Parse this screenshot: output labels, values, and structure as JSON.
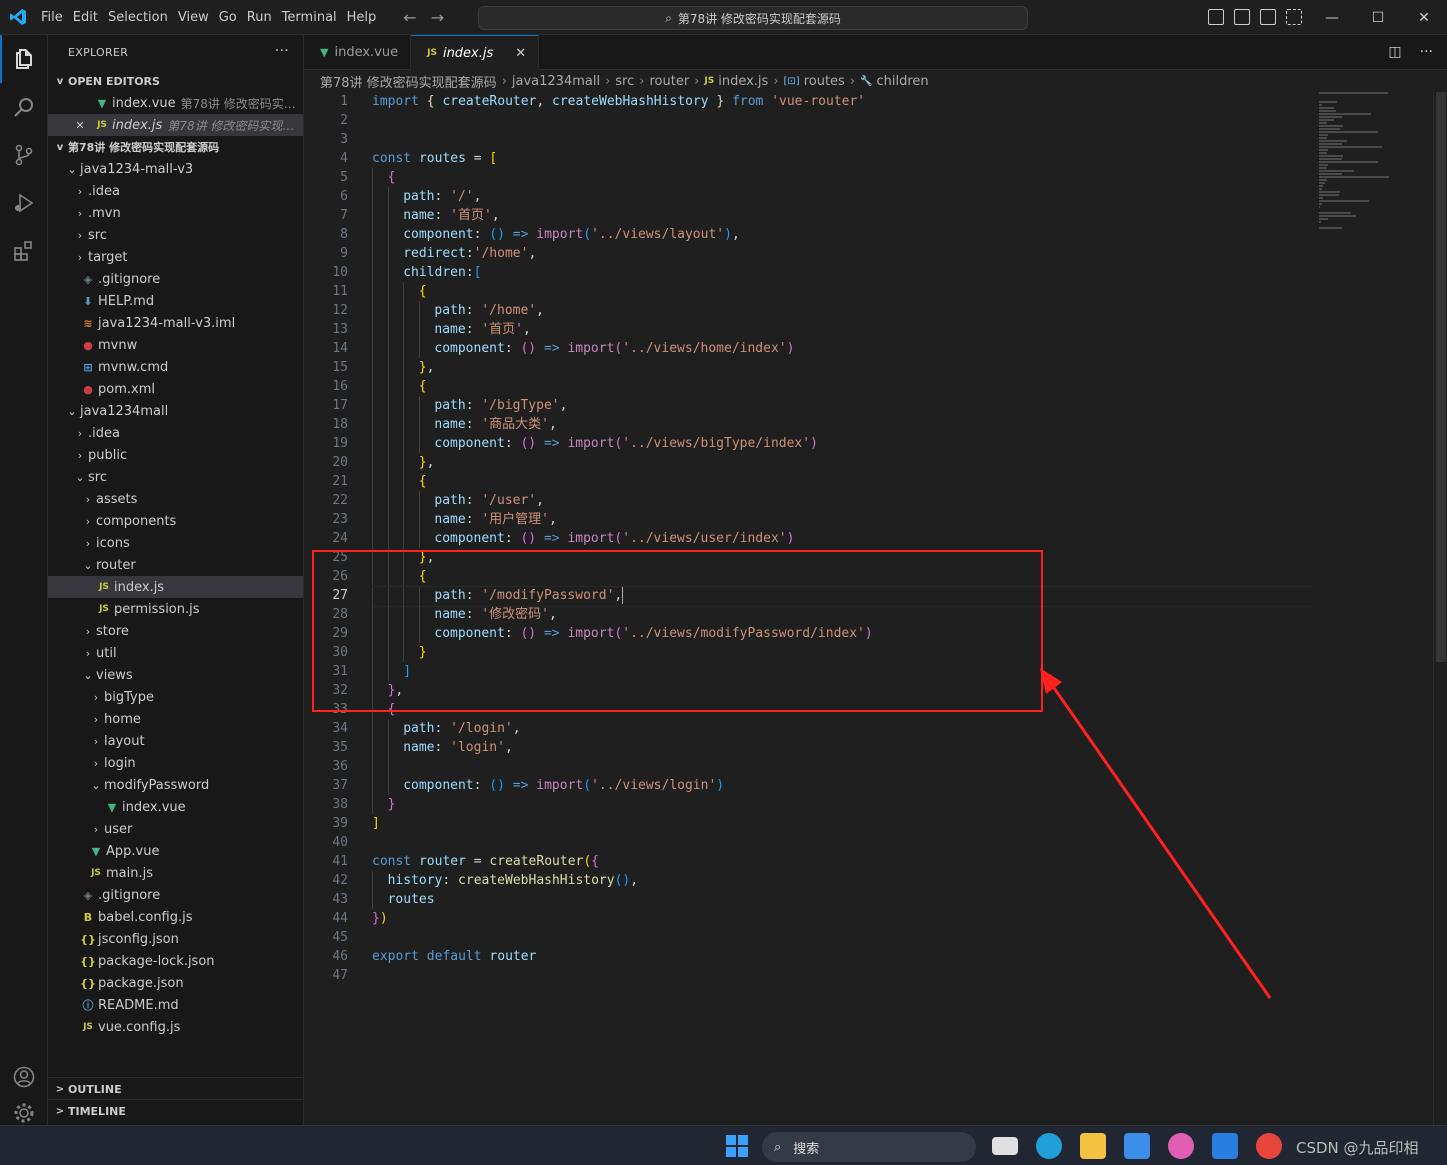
{
  "menu": [
    "File",
    "Edit",
    "Selection",
    "View",
    "Go",
    "Run",
    "Terminal",
    "Help"
  ],
  "command_center": "第78讲 修改密码实现配套源码",
  "explorer": {
    "title": "EXPLORER",
    "open_editors_label": "OPEN EDITORS",
    "open_editors": [
      {
        "name": "index.vue",
        "desc": "第78讲 修改密码实现配..."
      },
      {
        "name": "index.js",
        "desc": "第78讲 修改密码实现配套..."
      }
    ],
    "workspace_label": "第78讲 修改密码实现配套源码",
    "tree": [
      {
        "label": "第78讲 修改密码实现配套源码",
        "depth": 1,
        "chev": "v",
        "icon": ""
      },
      {
        "label": "java1234-mall-v3",
        "depth": 2,
        "chev": "v",
        "icon": ""
      },
      {
        "label": ".idea",
        "depth": 3,
        "chev": ">",
        "icon": ""
      },
      {
        "label": ".mvn",
        "depth": 3,
        "chev": ">",
        "icon": ""
      },
      {
        "label": "src",
        "depth": 3,
        "chev": ">",
        "icon": ""
      },
      {
        "label": "target",
        "depth": 3,
        "chev": ">",
        "icon": ""
      },
      {
        "label": ".gitignore",
        "depth": 3,
        "chev": "",
        "icon": "git"
      },
      {
        "label": "HELP.md",
        "depth": 3,
        "chev": "",
        "icon": "md"
      },
      {
        "label": "java1234-mall-v3.iml",
        "depth": 3,
        "chev": "",
        "icon": "xml"
      },
      {
        "label": "mvnw",
        "depth": 3,
        "chev": "",
        "icon": "red"
      },
      {
        "label": "mvnw.cmd",
        "depth": 3,
        "chev": "",
        "icon": "cmd"
      },
      {
        "label": "pom.xml",
        "depth": 3,
        "chev": "",
        "icon": "red"
      },
      {
        "label": "java1234mall",
        "depth": 2,
        "chev": "v",
        "icon": ""
      },
      {
        "label": ".idea",
        "depth": 3,
        "chev": ">",
        "icon": ""
      },
      {
        "label": "public",
        "depth": 3,
        "chev": ">",
        "icon": ""
      },
      {
        "label": "src",
        "depth": 3,
        "chev": "v",
        "icon": ""
      },
      {
        "label": "assets",
        "depth": 4,
        "chev": ">",
        "icon": ""
      },
      {
        "label": "components",
        "depth": 4,
        "chev": ">",
        "icon": ""
      },
      {
        "label": "icons",
        "depth": 4,
        "chev": ">",
        "icon": ""
      },
      {
        "label": "router",
        "depth": 4,
        "chev": "v",
        "icon": ""
      },
      {
        "label": "index.js",
        "depth": 5,
        "chev": "",
        "icon": "js",
        "selected": true
      },
      {
        "label": "permission.js",
        "depth": 5,
        "chev": "",
        "icon": "js"
      },
      {
        "label": "store",
        "depth": 4,
        "chev": ">",
        "icon": ""
      },
      {
        "label": "util",
        "depth": 4,
        "chev": ">",
        "icon": ""
      },
      {
        "label": "views",
        "depth": 4,
        "chev": "v",
        "icon": ""
      },
      {
        "label": "bigType",
        "depth": 5,
        "chev": ">",
        "icon": ""
      },
      {
        "label": "home",
        "depth": 5,
        "chev": ">",
        "icon": ""
      },
      {
        "label": "layout",
        "depth": 5,
        "chev": ">",
        "icon": ""
      },
      {
        "label": "login",
        "depth": 5,
        "chev": ">",
        "icon": ""
      },
      {
        "label": "modifyPassword",
        "depth": 5,
        "chev": "v",
        "icon": ""
      },
      {
        "label": "index.vue",
        "depth": 6,
        "chev": "",
        "icon": "vue"
      },
      {
        "label": "user",
        "depth": 5,
        "chev": ">",
        "icon": ""
      },
      {
        "label": "App.vue",
        "depth": 4,
        "chev": "",
        "icon": "vue"
      },
      {
        "label": "main.js",
        "depth": 4,
        "chev": "",
        "icon": "js"
      },
      {
        "label": ".gitignore",
        "depth": 3,
        "chev": "",
        "icon": "git"
      },
      {
        "label": "babel.config.js",
        "depth": 3,
        "chev": "",
        "icon": "babel"
      },
      {
        "label": "jsconfig.json",
        "depth": 3,
        "chev": "",
        "icon": "json"
      },
      {
        "label": "package-lock.json",
        "depth": 3,
        "chev": "",
        "icon": "json"
      },
      {
        "label": "package.json",
        "depth": 3,
        "chev": "",
        "icon": "json"
      },
      {
        "label": "README.md",
        "depth": 3,
        "chev": "",
        "icon": "info"
      },
      {
        "label": "vue.config.js",
        "depth": 3,
        "chev": "",
        "icon": "js"
      }
    ],
    "outline_label": "OUTLINE",
    "timeline_label": "TIMELINE"
  },
  "tabs": [
    {
      "name": "index.vue",
      "icon": "vue",
      "active": false
    },
    {
      "name": "index.js",
      "icon": "js",
      "active": true
    }
  ],
  "breadcrumb": [
    "第78讲 修改密码实现配套源码",
    "java1234mall",
    "src",
    "router",
    "index.js",
    "routes",
    "children"
  ],
  "code": {
    "current_line": 27,
    "lines": [
      [
        [
          "k",
          "import "
        ],
        [
          "pl",
          "{ "
        ],
        [
          "v",
          "createRouter"
        ],
        [
          "pl",
          ", "
        ],
        [
          "v",
          "createWebHashHistory"
        ],
        [
          "pl",
          " } "
        ],
        [
          "k",
          "from "
        ],
        [
          "s",
          "'vue-router'"
        ]
      ],
      [],
      [],
      [
        [
          "k",
          "const "
        ],
        [
          "v",
          "routes"
        ],
        [
          "pl",
          " = "
        ],
        [
          "b1",
          "["
        ]
      ],
      [
        [
          "i",
          1
        ],
        [
          "b2",
          "{"
        ]
      ],
      [
        [
          "i",
          2
        ],
        [
          "v",
          "path"
        ],
        [
          "pl",
          ": "
        ],
        [
          "s",
          "'/'"
        ],
        [
          "pl",
          ","
        ]
      ],
      [
        [
          "i",
          2
        ],
        [
          "v",
          "name"
        ],
        [
          "pl",
          ": "
        ],
        [
          "s",
          "'首页'"
        ],
        [
          "pl",
          ","
        ]
      ],
      [
        [
          "i",
          2
        ],
        [
          "v",
          "component"
        ],
        [
          "pl",
          ": "
        ],
        [
          "b3",
          "()"
        ],
        [
          "k",
          " => "
        ],
        [
          "kc",
          "import"
        ],
        [
          "b3",
          "("
        ],
        [
          "s",
          "'../views/layout'"
        ],
        [
          "b3",
          ")"
        ],
        [
          "pl",
          ","
        ]
      ],
      [
        [
          "i",
          2
        ],
        [
          "v",
          "redirect"
        ],
        [
          "pl",
          ":"
        ],
        [
          "s",
          "'/home'"
        ],
        [
          "pl",
          ","
        ]
      ],
      [
        [
          "i",
          2
        ],
        [
          "v",
          "children"
        ],
        [
          "pl",
          ":"
        ],
        [
          "b3",
          "["
        ]
      ],
      [
        [
          "i",
          3
        ],
        [
          "b1",
          "{"
        ]
      ],
      [
        [
          "i",
          4
        ],
        [
          "v",
          "path"
        ],
        [
          "pl",
          ": "
        ],
        [
          "s",
          "'/home'"
        ],
        [
          "pl",
          ","
        ]
      ],
      [
        [
          "i",
          4
        ],
        [
          "v",
          "name"
        ],
        [
          "pl",
          ": "
        ],
        [
          "s",
          "'首页'"
        ],
        [
          "pl",
          ","
        ]
      ],
      [
        [
          "i",
          4
        ],
        [
          "v",
          "component"
        ],
        [
          "pl",
          ": "
        ],
        [
          "b2",
          "()"
        ],
        [
          "k",
          " => "
        ],
        [
          "kc",
          "import"
        ],
        [
          "b2",
          "("
        ],
        [
          "s",
          "'../views/home/index'"
        ],
        [
          "b2",
          ")"
        ]
      ],
      [
        [
          "i",
          3
        ],
        [
          "b1",
          "}"
        ],
        [
          "pl",
          ","
        ]
      ],
      [
        [
          "i",
          3
        ],
        [
          "b1",
          "{"
        ]
      ],
      [
        [
          "i",
          4
        ],
        [
          "v",
          "path"
        ],
        [
          "pl",
          ": "
        ],
        [
          "s",
          "'/bigType'"
        ],
        [
          "pl",
          ","
        ]
      ],
      [
        [
          "i",
          4
        ],
        [
          "v",
          "name"
        ],
        [
          "pl",
          ": "
        ],
        [
          "s",
          "'商品大类'"
        ],
        [
          "pl",
          ","
        ]
      ],
      [
        [
          "i",
          4
        ],
        [
          "v",
          "component"
        ],
        [
          "pl",
          ": "
        ],
        [
          "b2",
          "()"
        ],
        [
          "k",
          " => "
        ],
        [
          "kc",
          "import"
        ],
        [
          "b2",
          "("
        ],
        [
          "s",
          "'../views/bigType/index'"
        ],
        [
          "b2",
          ")"
        ]
      ],
      [
        [
          "i",
          3
        ],
        [
          "b1",
          "}"
        ],
        [
          "pl",
          ","
        ]
      ],
      [
        [
          "i",
          3
        ],
        [
          "b1",
          "{"
        ]
      ],
      [
        [
          "i",
          4
        ],
        [
          "v",
          "path"
        ],
        [
          "pl",
          ": "
        ],
        [
          "s",
          "'/user'"
        ],
        [
          "pl",
          ","
        ]
      ],
      [
        [
          "i",
          4
        ],
        [
          "v",
          "name"
        ],
        [
          "pl",
          ": "
        ],
        [
          "s",
          "'用户管理'"
        ],
        [
          "pl",
          ","
        ]
      ],
      [
        [
          "i",
          4
        ],
        [
          "v",
          "component"
        ],
        [
          "pl",
          ": "
        ],
        [
          "b2",
          "()"
        ],
        [
          "k",
          " => "
        ],
        [
          "kc",
          "import"
        ],
        [
          "b2",
          "("
        ],
        [
          "s",
          "'../views/user/index'"
        ],
        [
          "b2",
          ")"
        ]
      ],
      [
        [
          "i",
          3
        ],
        [
          "b1",
          "}"
        ],
        [
          "pl",
          ","
        ]
      ],
      [
        [
          "i",
          3
        ],
        [
          "b1",
          "{"
        ]
      ],
      [
        [
          "i",
          4
        ],
        [
          "v",
          "path"
        ],
        [
          "pl",
          ": "
        ],
        [
          "s",
          "'/modifyPassword'"
        ],
        [
          "pl",
          ","
        ]
      ],
      [
        [
          "i",
          4
        ],
        [
          "v",
          "name"
        ],
        [
          "pl",
          ": "
        ],
        [
          "s",
          "'修改密码'"
        ],
        [
          "pl",
          ","
        ]
      ],
      [
        [
          "i",
          4
        ],
        [
          "v",
          "component"
        ],
        [
          "pl",
          ": "
        ],
        [
          "b2",
          "()"
        ],
        [
          "k",
          " => "
        ],
        [
          "kc",
          "import"
        ],
        [
          "b2",
          "("
        ],
        [
          "s",
          "'../views/modifyPassword/index'"
        ],
        [
          "b2",
          ")"
        ]
      ],
      [
        [
          "i",
          3
        ],
        [
          "b1",
          "}"
        ]
      ],
      [
        [
          "i",
          2
        ],
        [
          "b3",
          "]"
        ]
      ],
      [
        [
          "i",
          1
        ],
        [
          "b2",
          "}"
        ],
        [
          "pl",
          ","
        ]
      ],
      [
        [
          "i",
          1
        ],
        [
          "b2",
          "{"
        ]
      ],
      [
        [
          "i",
          2
        ],
        [
          "v",
          "path"
        ],
        [
          "pl",
          ": "
        ],
        [
          "s",
          "'/login'"
        ],
        [
          "pl",
          ","
        ]
      ],
      [
        [
          "i",
          2
        ],
        [
          "v",
          "name"
        ],
        [
          "pl",
          ": "
        ],
        [
          "s",
          "'login'"
        ],
        [
          "pl",
          ","
        ]
      ],
      [
        [
          "i",
          2
        ]
      ],
      [
        [
          "i",
          2
        ],
        [
          "v",
          "component"
        ],
        [
          "pl",
          ": "
        ],
        [
          "b3",
          "()"
        ],
        [
          "k",
          " => "
        ],
        [
          "kc",
          "import"
        ],
        [
          "b3",
          "("
        ],
        [
          "s",
          "'../views/login'"
        ],
        [
          "b3",
          ")"
        ]
      ],
      [
        [
          "i",
          1
        ],
        [
          "b2",
          "}"
        ]
      ],
      [
        [
          "b1",
          "]"
        ]
      ],
      [],
      [
        [
          "k",
          "const "
        ],
        [
          "v",
          "router"
        ],
        [
          "pl",
          " = "
        ],
        [
          "f",
          "createRouter"
        ],
        [
          "b1",
          "("
        ],
        [
          "b2",
          "{"
        ]
      ],
      [
        [
          "i",
          1
        ],
        [
          "v",
          "history"
        ],
        [
          "pl",
          ": "
        ],
        [
          "f",
          "createWebHashHistory"
        ],
        [
          "b3",
          "()"
        ],
        [
          "pl",
          ","
        ]
      ],
      [
        [
          "i",
          1
        ],
        [
          "v",
          "routes"
        ]
      ],
      [
        [
          "b2",
          "}"
        ],
        [
          "b1",
          ")"
        ]
      ],
      [],
      [
        [
          "k",
          "export "
        ],
        [
          "k",
          "default "
        ],
        [
          "v",
          "router"
        ]
      ],
      []
    ]
  },
  "taskbar": {
    "search_label": "搜索",
    "watermark": "CSDN @九品印相"
  }
}
